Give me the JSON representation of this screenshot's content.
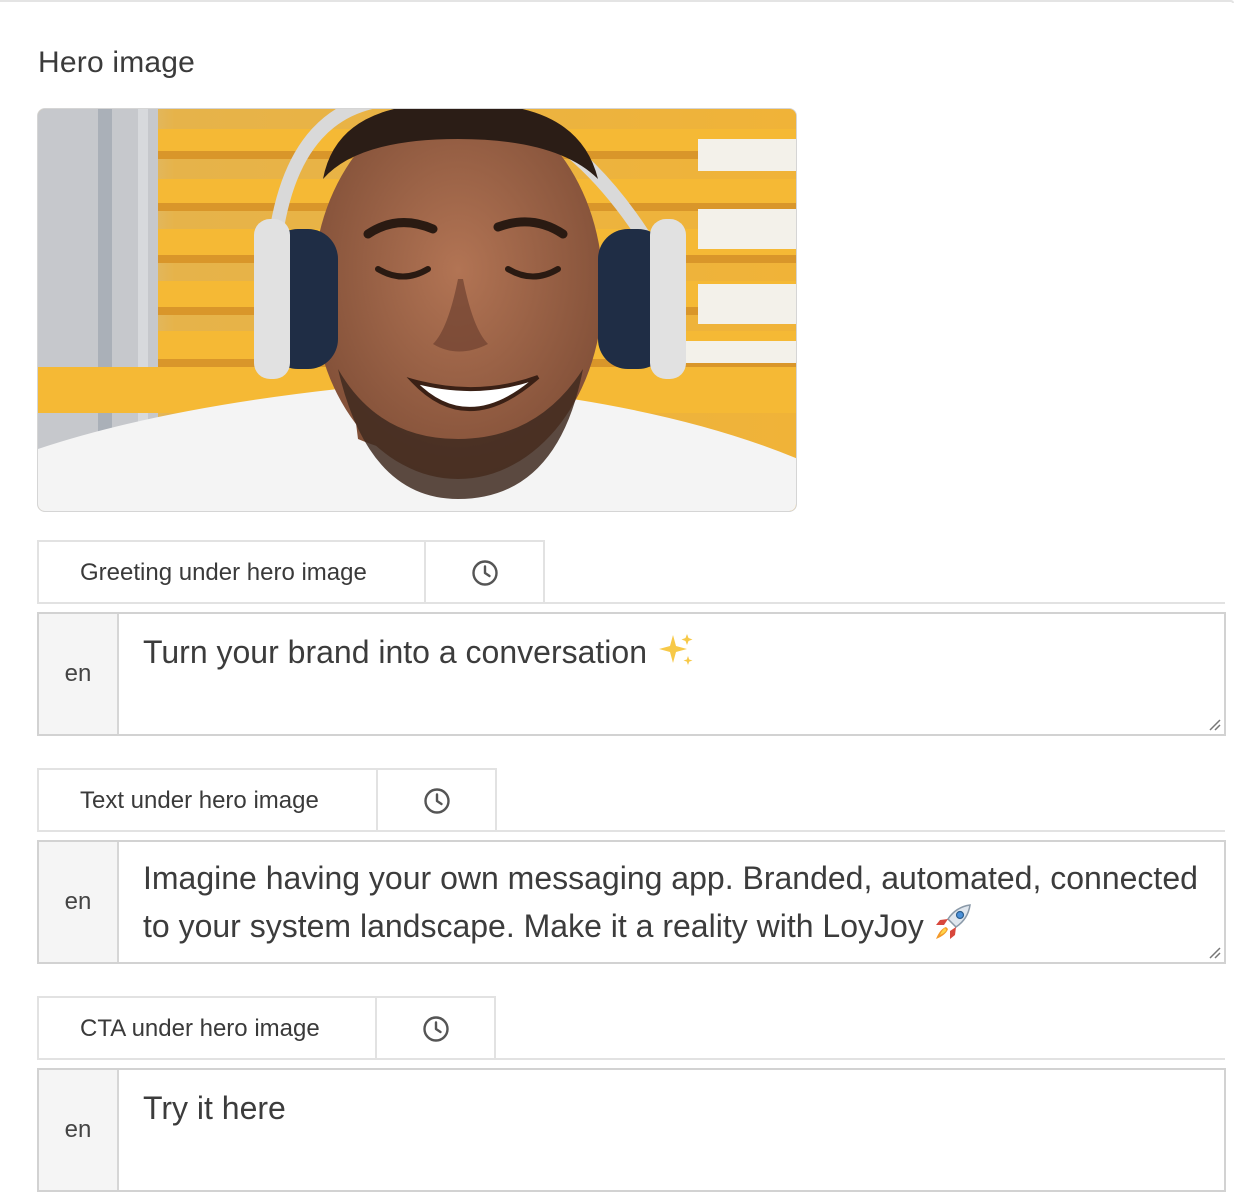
{
  "section": {
    "title": "Hero image"
  },
  "hero_image": {
    "alt": "Smiling man wearing headphones in front of yellow stairs",
    "colors": {
      "background": "#f2b233",
      "skin": "#9a6346",
      "shirt": "#f4f4f4"
    }
  },
  "fields": [
    {
      "label": "Greeting under hero image",
      "history_icon": "clock-icon",
      "language": "en",
      "value": "Turn your brand into a conversation",
      "trailing_emoji": "sparkles"
    },
    {
      "label": "Text under hero image",
      "history_icon": "clock-icon",
      "language": "en",
      "value": "Imagine having your own messaging app. Branded, automated, connected to your system landscape. Make it a reality with LoyJoy",
      "trailing_emoji": "rocket"
    },
    {
      "label": "CTA under hero image",
      "history_icon": "clock-icon",
      "language": "en",
      "value": "Try it here",
      "trailing_emoji": ""
    }
  ]
}
